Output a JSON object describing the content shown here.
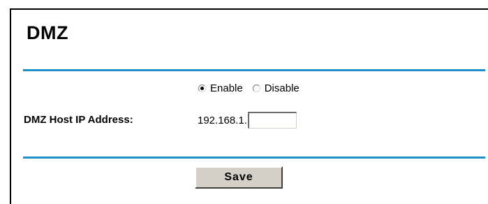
{
  "page": {
    "title": "DMZ"
  },
  "dmz_status": {
    "options": [
      {
        "label": "Enable",
        "checked": true
      },
      {
        "label": "Disable",
        "checked": false
      }
    ]
  },
  "host_ip": {
    "label": "DMZ Host IP Address:",
    "prefix": "192.168.1.",
    "value": ""
  },
  "actions": {
    "save_label": "Save"
  },
  "colors": {
    "rule": "#1e90c8",
    "button_face": "#d4d0c8"
  }
}
